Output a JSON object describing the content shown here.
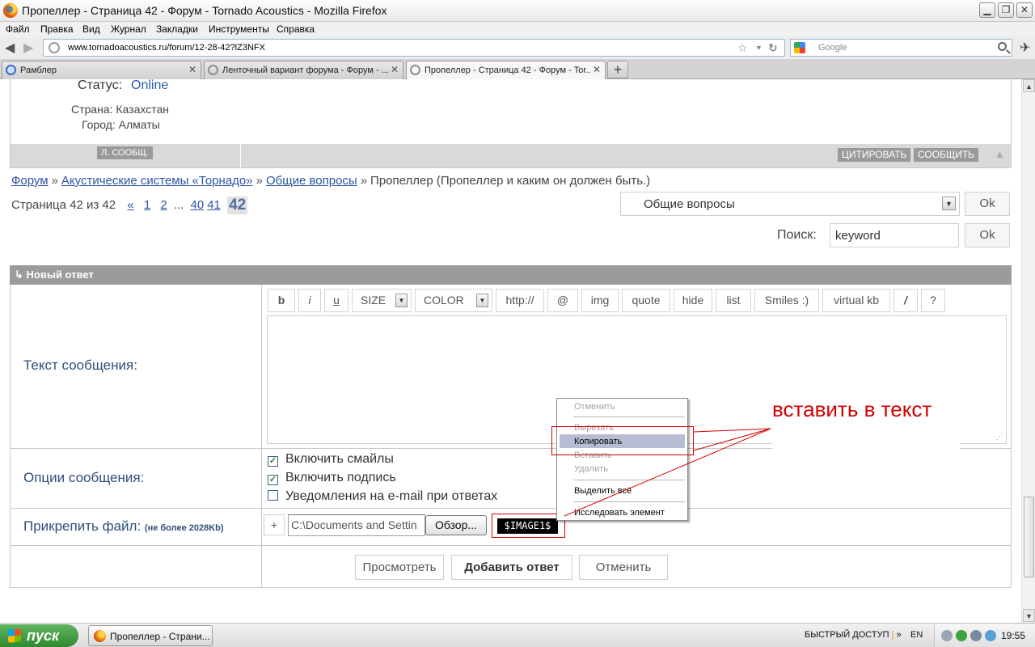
{
  "window": {
    "title": "Пропеллер - Страница 42 - Форум - Tornado Acoustics - Mozilla Firefox",
    "min": "▁",
    "max": "❐",
    "close": "✕"
  },
  "menu": [
    "Файл",
    "Правка",
    "Вид",
    "Журнал",
    "Закладки",
    "Инструменты",
    "Справка"
  ],
  "nav": {
    "url": "www.tornadoacoustics.ru/forum/12-28-42?lZ3NFX",
    "search_placeholder": "Google",
    "back": "◀",
    "forward": "▶",
    "star": "☆",
    "dropdown": "▼",
    "reload": "↻"
  },
  "tabs": [
    {
      "label": "Рамблер",
      "close": "✕"
    },
    {
      "label": "Ленточный вариант форума - Форум - ...",
      "close": "✕"
    },
    {
      "label": "Пропеллер - Страница 42 - Форум - Tor...",
      "close": "✕"
    }
  ],
  "newtab": "+",
  "user": {
    "status_label": "Статус:",
    "status_value": "Online",
    "country": "Страна: Казахстан",
    "city": "Город: Алматы",
    "pm_button": "Л. СООБЩ.",
    "quote_button": "ЦИТИРОВАТЬ",
    "report_button": "СООБЩИТЬ",
    "up_arrow": "▲"
  },
  "breadcrumb": {
    "items": [
      "Форум",
      "Акустические системы «Торнадо»",
      "Общие вопросы"
    ],
    "separator": "»",
    "current": "Пропеллер (Пропеллер и каким он должен быть.)"
  },
  "pager": {
    "label": "Страница 42 из 42",
    "prev": "«",
    "pages": [
      "1",
      "2"
    ],
    "ellipsis": "...",
    "pages_end": [
      "40",
      "41"
    ],
    "current": "42"
  },
  "forum_select": {
    "value": "Общие вопросы",
    "ok": "Ok"
  },
  "search": {
    "label": "Поиск:",
    "value": "keyword",
    "ok": "Ok"
  },
  "reply": {
    "header": "Новый ответ",
    "header_icon": "↳",
    "text_label": "Текст сообщения:",
    "options_label": "Опции сообщения:",
    "attach_label": "Прикрепить файл:",
    "attach_hint": "(не более 2028Kb)",
    "toolbar": {
      "b": "b",
      "i": "i",
      "u": "u",
      "size": "SIZE",
      "color": "COLOR",
      "http": "http://",
      "at": "@",
      "img": "img",
      "quote": "quote",
      "hide": "hide",
      "list": "list",
      "smiles": "Smiles :)",
      "virtual_kb": "virtual kb",
      "slash": "/",
      "help": "?"
    },
    "options": [
      {
        "label": "Включить смайлы",
        "checked": true
      },
      {
        "label": "Включить подпись",
        "checked": true
      },
      {
        "label": "Уведомления на e-mail при ответах",
        "checked": false
      }
    ],
    "check_mark": "✓",
    "plus": "+",
    "file_value": "C:\\Documents and Settin",
    "browse": "Обзор...",
    "image_token": "$IMAGE1$",
    "resize_grip": "⋰",
    "preview_button": "Просмотреть",
    "submit_button": "Добавить ответ",
    "cancel_button": "Отменить"
  },
  "context_menu": {
    "undo": "Отменить",
    "cut": "Вырезать",
    "copy": "Копировать",
    "paste": "Вставить",
    "delete": "Удалить",
    "select_all": "Выделить всё",
    "inspect": "Исследовать элемент"
  },
  "annotation": {
    "text": "вставить в текст",
    "color": "#d30000"
  },
  "scrollbar": {
    "up": "▲",
    "down": "▼"
  },
  "taskbar": {
    "start": "пуск",
    "task": "Пропеллер - Страни...",
    "quick_launch": "БЫСТРЫЙ ДОСТУП",
    "chevron": "»",
    "lang": "EN",
    "clock": "19:55"
  }
}
